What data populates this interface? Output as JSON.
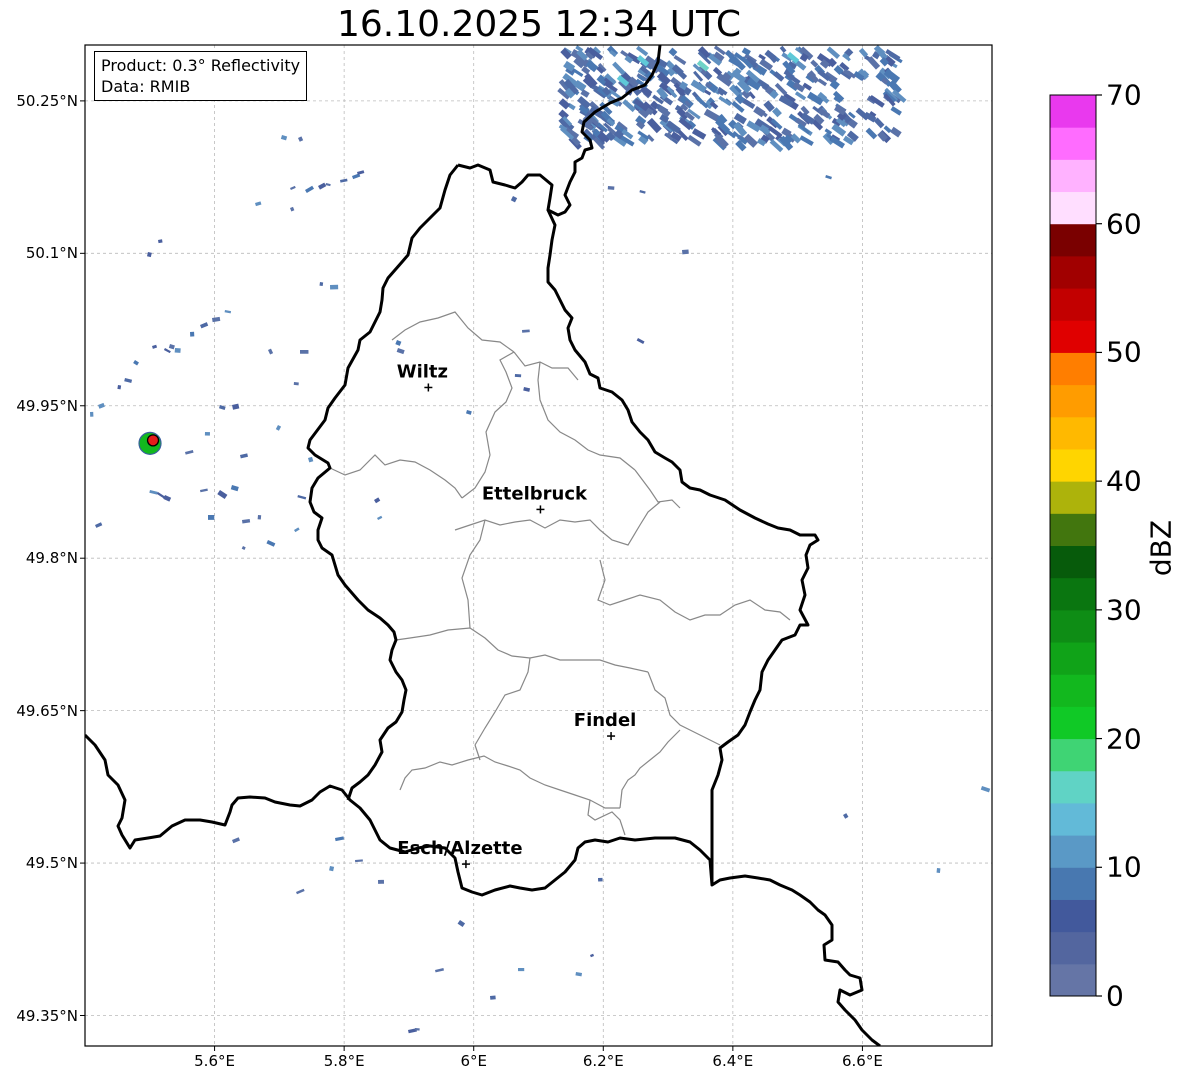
{
  "title": "16.10.2025 12:34 UTC",
  "info": {
    "product": "Product: 0.3° Reflectivity",
    "data_source": "Data: RMIB"
  },
  "map": {
    "lon_range": [
      5.4,
      6.8
    ],
    "lat_range": [
      49.32,
      50.305
    ],
    "lat_ticks": [
      {
        "value": 50.25,
        "label": "50.25°N"
      },
      {
        "value": 50.1,
        "label": "50.1°N"
      },
      {
        "value": 49.95,
        "label": "49.95°N"
      },
      {
        "value": 49.8,
        "label": "49.8°N"
      },
      {
        "value": 49.65,
        "label": "49.65°N"
      },
      {
        "value": 49.5,
        "label": "49.5°N"
      },
      {
        "value": 49.35,
        "label": "49.35°N"
      }
    ],
    "lon_ticks": [
      {
        "value": 5.6,
        "label": "5.6°E"
      },
      {
        "value": 5.8,
        "label": "5.8°E"
      },
      {
        "value": 6.0,
        "label": "6°E"
      },
      {
        "value": 6.2,
        "label": "6.2°E"
      },
      {
        "value": 6.4,
        "label": "6.4°E"
      },
      {
        "value": 6.6,
        "label": "6.6°E"
      }
    ],
    "cities": [
      {
        "name": "Wiltz",
        "lon": 5.93,
        "lat": 49.968
      },
      {
        "name": "Ettelbruck",
        "lon": 6.103,
        "lat": 49.848
      },
      {
        "name": "Findel",
        "lon": 6.212,
        "lat": 49.625
      },
      {
        "name": "Esch/Alzette",
        "lon": 5.988,
        "lat": 49.499
      }
    ],
    "radar_site": {
      "lon": 5.505,
      "lat": 49.914
    }
  },
  "colorbar": {
    "label": "dBZ",
    "min": 0,
    "max": 70,
    "tick_values": [
      0,
      10,
      20,
      30,
      40,
      50,
      60,
      70
    ],
    "colors": [
      "#6575a6",
      "#53669f",
      "#42599c",
      "#4878b0",
      "#5a99c6",
      "#62bad8",
      "#60d3c5",
      "#3fd474",
      "#10c926",
      "#12b81e",
      "#10a318",
      "#0e8d15",
      "#0a7610",
      "#075b0b",
      "#42760e",
      "#adb30b",
      "#ffd500",
      "#ffb900",
      "#ff9c00",
      "#ff7e00",
      "#e00000",
      "#c20000",
      "#a10000",
      "#7a0000",
      "#ffdeff",
      "#ffb2ff",
      "#ff6cff",
      "#e939ee"
    ]
  }
}
